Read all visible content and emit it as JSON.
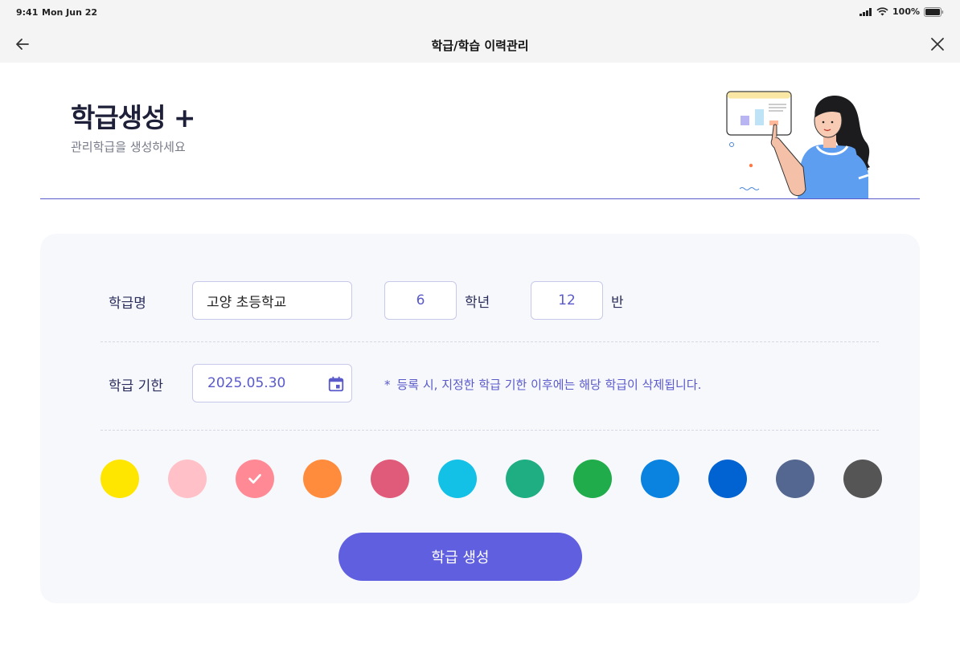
{
  "status_bar": {
    "time": "9:41",
    "date": "Mon Jun 22",
    "battery": "100%"
  },
  "nav": {
    "title": "학급/학습 이력관리",
    "back_icon": "arrow-left-icon",
    "close_icon": "close-icon"
  },
  "header": {
    "title": "학급생성 +",
    "subtitle": "관리학급을 생성하세요"
  },
  "form": {
    "class_name_label": "학급명",
    "class_name_value": "고양 초등학교",
    "grade_value": "6",
    "grade_unit": "학년",
    "class_value": "12",
    "class_unit": "반",
    "deadline_label": "학급 기한",
    "deadline_value": "2025.05.30",
    "notice_star": "*",
    "notice_text": "등록 시, 지정한 학급 기한 이후에는 해당 학급이 삭제됩니다."
  },
  "colors": {
    "accent": "#5f5fdf",
    "options": [
      "#ffe600",
      "#ffc0c8",
      "#ff8a96",
      "#ff8c3c",
      "#e05b7a",
      "#13c0e6",
      "#1eae82",
      "#20ac4a",
      "#0a83e0",
      "#0162d2",
      "#546790",
      "#555555"
    ],
    "selected_index": 2
  },
  "submit": {
    "label": "학급 생성"
  }
}
